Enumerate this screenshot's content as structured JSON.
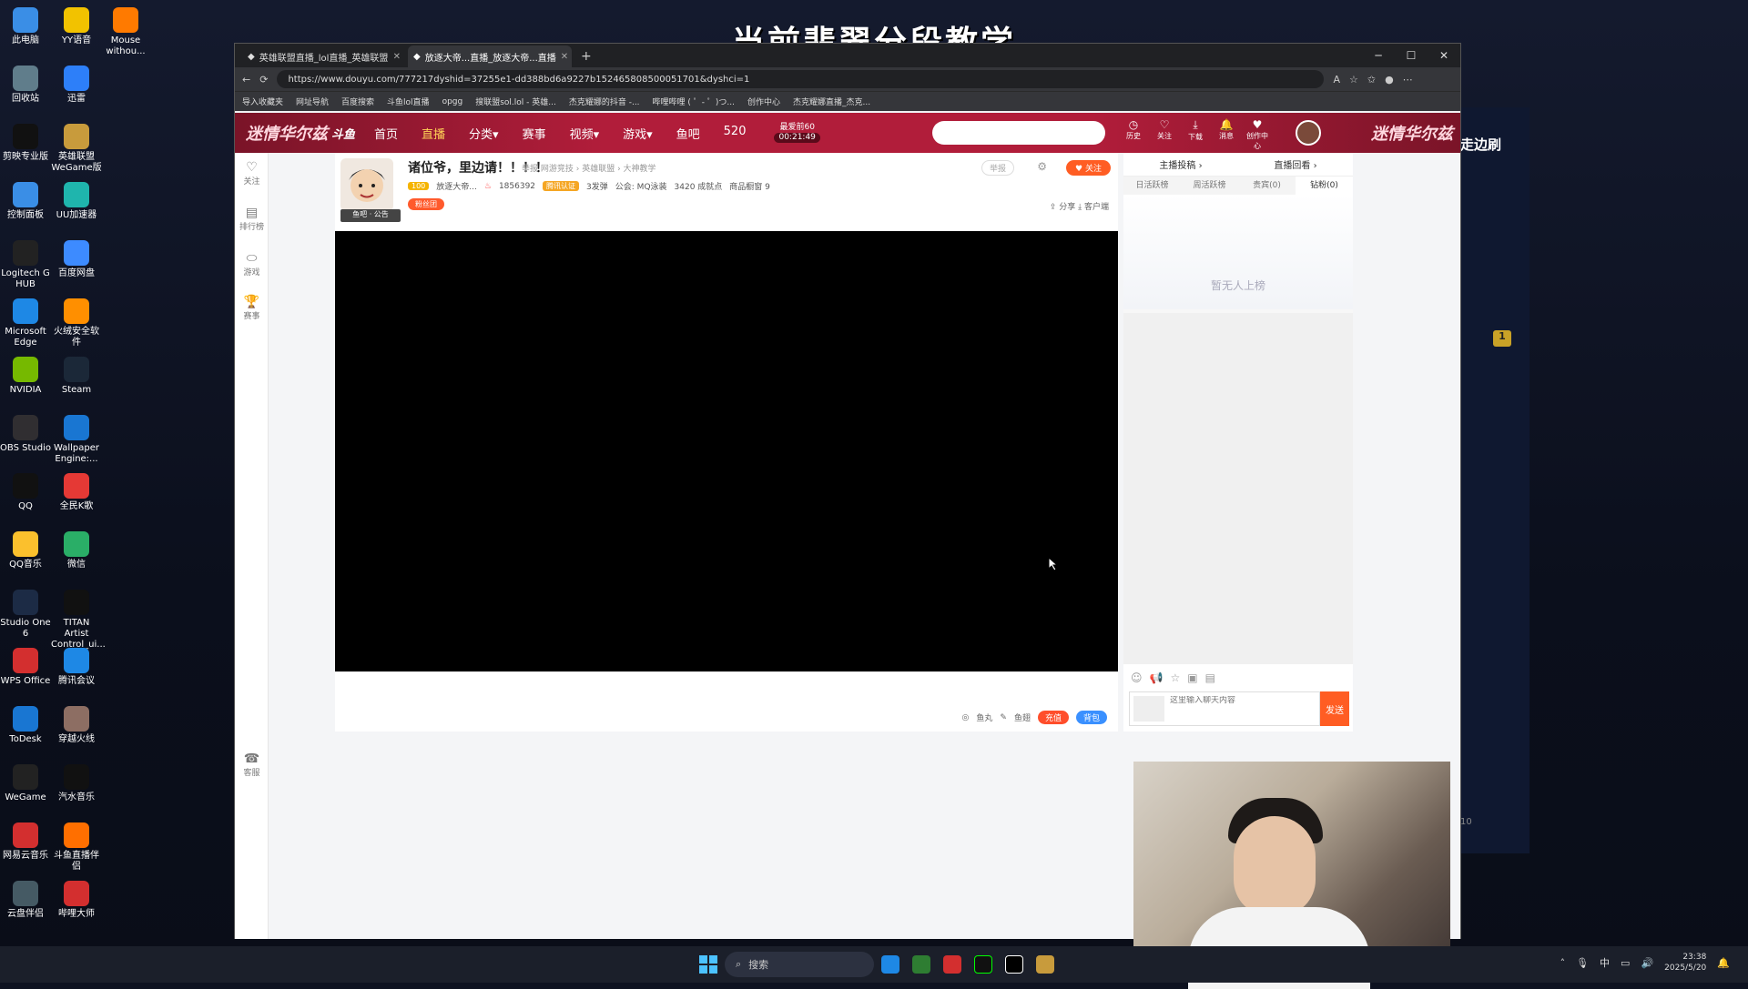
{
  "overlay_title": "当前翡翠分段教学",
  "desktop_icons": [
    {
      "label": "此电脑",
      "color": "#3a8ee6"
    },
    {
      "label": "YY语音",
      "color": "#f2c200"
    },
    {
      "label": "Mouse withou...",
      "color": "#ff7a00"
    },
    {
      "label": "回收站",
      "color": "#607d8b"
    },
    {
      "label": "迅雷",
      "color": "#2d7ff9"
    },
    {
      "label": "剪映专业版",
      "color": "#111"
    },
    {
      "label": "英雄联盟WeGame版",
      "color": "#c89b3c"
    },
    {
      "label": "控制面板",
      "color": "#3a8ee6"
    },
    {
      "label": "UU加速器",
      "color": "#1fb5ad"
    },
    {
      "label": "Logitech G HUB",
      "color": "#222"
    },
    {
      "label": "百度网盘",
      "color": "#3d8bff"
    },
    {
      "label": "Microsoft Edge",
      "color": "#1e88e5"
    },
    {
      "label": "火绒安全软件",
      "color": "#ff8f00"
    },
    {
      "label": "NVIDIA",
      "color": "#76b900"
    },
    {
      "label": "Steam",
      "color": "#1b2838"
    },
    {
      "label": "OBS Studio",
      "color": "#302e31"
    },
    {
      "label": "Wallpaper Engine:...",
      "color": "#1976d2"
    },
    {
      "label": "QQ",
      "color": "#111"
    },
    {
      "label": "全民K歌",
      "color": "#e53935"
    },
    {
      "label": "QQ音乐",
      "color": "#fbc02d"
    },
    {
      "label": "微信",
      "color": "#2aae67"
    },
    {
      "label": "Studio One 6",
      "color": "#1c2b45"
    },
    {
      "label": "TITAN Artist Control_ui...",
      "color": "#111"
    },
    {
      "label": "WPS Office",
      "color": "#d32f2f"
    },
    {
      "label": "腾讯会议",
      "color": "#1e88e5"
    },
    {
      "label": "ToDesk",
      "color": "#1976d2"
    },
    {
      "label": "穿越火线",
      "color": "#8d6e63"
    },
    {
      "label": "WeGame",
      "color": "#222"
    },
    {
      "label": "汽水音乐",
      "color": "#111"
    },
    {
      "label": "网易云音乐",
      "color": "#d32f2f"
    },
    {
      "label": "斗鱼直播伴侣",
      "color": "#ff6f00"
    },
    {
      "label": "云盘伴侣",
      "color": "#455a64"
    },
    {
      "label": "哔哩大师",
      "color": "#d32f2f"
    }
  ],
  "right_app": {
    "text": "走边刷",
    "badge": "1",
    "val": "10"
  },
  "browser": {
    "tabs": [
      {
        "label": "英雄联盟直播_lol直播_英雄联盟",
        "active": false
      },
      {
        "label": "放逐大帝...直播_放逐大帝...直播",
        "active": true
      }
    ],
    "url": "https://www.douyu.com/777217dyshid=37255e1-dd388bd6a9227b152465808500051701&dyshci=1",
    "bookmarks": [
      "导入收藏夹",
      "网址导航",
      "百度搜索",
      "斗鱼lol直播",
      "opgg",
      "搜联盟sol.lol - 英雄...",
      "杰克耀娜的抖音 -...",
      "哔哩哔哩 ( ゜- ゜)つ...",
      "创作中心",
      "杰克耀娜直播_杰克..."
    ]
  },
  "site": {
    "logo": "迷情华尔兹",
    "brand": "斗鱼",
    "nav": [
      {
        "label": "首页",
        "on": false
      },
      {
        "label": "直播",
        "on": true
      },
      {
        "label": "分类▾",
        "on": false
      },
      {
        "label": "赛事",
        "on": false
      },
      {
        "label": "视频▾",
        "on": false
      },
      {
        "label": "游戏▾",
        "on": false
      },
      {
        "label": "鱼吧",
        "on": false
      },
      {
        "label": "520",
        "on": false
      }
    ],
    "timer_label": "最爱前60",
    "timer": "00:21:49",
    "header_icons": [
      "历史",
      "关注",
      "下载",
      "消息",
      "创作中心"
    ]
  },
  "leftbar": [
    "关注",
    "排行榜",
    "游戏",
    "赛事",
    "客服"
  ],
  "room": {
    "title": "诸位爷，里边请！！！！",
    "report": "举报",
    "crumb": "网游竞技 › 英雄联盟 › 大神教学",
    "anchor_tag": "鱼吧 · 公告",
    "level": "100",
    "name": "放逐大帝...",
    "hot": "1856392",
    "cert": "腾讯认证",
    "num1": "3发弹",
    "guild": "公会: MQ泳装",
    "points": "3420 成就点",
    "gifts": "商品橱窗 9",
    "fan": "粉丝团",
    "follow": "关注",
    "report_btn": "举报",
    "share": "分享",
    "client": "客户端"
  },
  "bottom": {
    "fish": "鱼丸",
    "fishball": "鱼翅",
    "recharge": "充值",
    "bag": "背包"
  },
  "side": {
    "top": [
      "主播投稿 ›",
      "直播回看 ›"
    ],
    "tabs": [
      "日活跃榜",
      "周活跃榜",
      "贵宾(0)",
      "钻粉(0)"
    ],
    "empty": "暂无人上榜",
    "placeholder": "这里输入聊天内容",
    "send": "发送"
  },
  "taskbar": {
    "search": "搜索",
    "time": "23:38",
    "date": "2025/5/20",
    "ime": "中"
  }
}
